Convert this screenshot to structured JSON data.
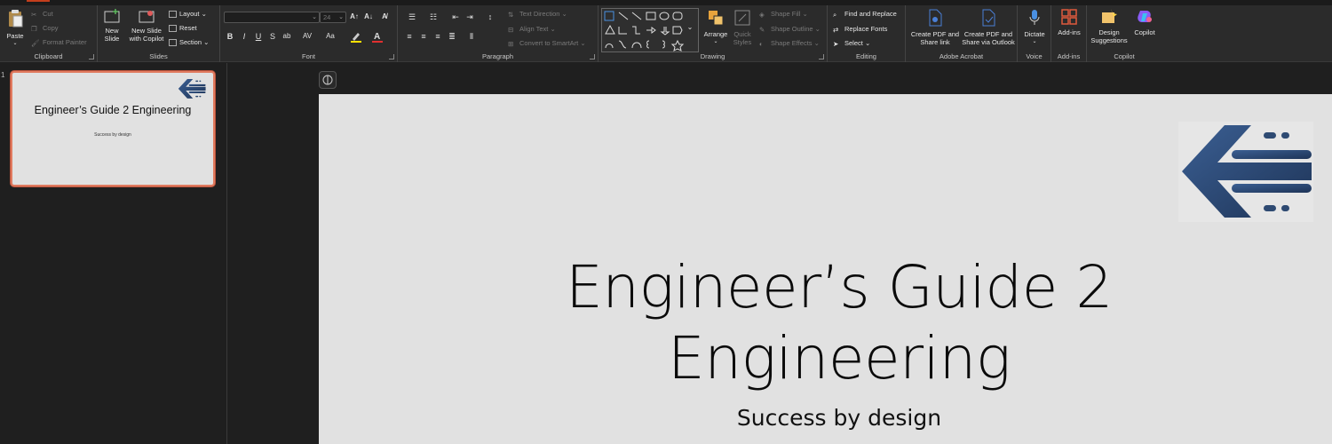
{
  "ribbon": {
    "clipboard": {
      "label": "Clipboard",
      "paste": "Paste",
      "cut": "Cut",
      "copy": "Copy",
      "format_painter": "Format Painter"
    },
    "slides": {
      "label": "Slides",
      "new_slide": "New Slide",
      "new_slide_copilot": "New Slide with Copilot",
      "layout": "Layout",
      "reset": "Reset",
      "section": "Section"
    },
    "font": {
      "label": "Font",
      "font_size": "24",
      "bold": "B",
      "italic": "I",
      "underline": "U",
      "strike": "S",
      "shadow": "ab",
      "spacing": "AV",
      "case": "Aa"
    },
    "paragraph": {
      "label": "Paragraph",
      "text_direction": "Text Direction",
      "align_text": "Align Text",
      "convert_smartart": "Convert to SmartArt"
    },
    "drawing": {
      "label": "Drawing",
      "arrange": "Arrange",
      "quick_styles": "Quick Styles",
      "shape_fill": "Shape Fill",
      "shape_outline": "Shape Outline",
      "shape_effects": "Shape Effects"
    },
    "editing": {
      "label": "Editing",
      "find_replace": "Find and Replace",
      "replace_fonts": "Replace Fonts",
      "select": "Select"
    },
    "acrobat": {
      "label": "Adobe Acrobat",
      "create_pdf_share": "Create PDF and Share link",
      "create_pdf_outlook": "Create PDF and Share via Outlook"
    },
    "voice": {
      "label": "Voice",
      "dictate": "Dictate"
    },
    "addins": {
      "label": "Add-ins",
      "addins": "Add-ins"
    },
    "copilot": {
      "label": "Copilot",
      "design_suggestions": "Design Suggestions",
      "copilot": "Copilot"
    }
  },
  "thumbnails": [
    {
      "number": "1",
      "title": "Engineer’s Guide 2 Engineering",
      "subtitle": "Success by design"
    }
  ],
  "slide": {
    "title": "Engineer’s Guide 2 Engineering",
    "subtitle": "Success by design"
  },
  "colors": {
    "accent": "#c43e1c",
    "logo_blue": "#2e4a72",
    "slide_bg": "#e1e1e1"
  }
}
